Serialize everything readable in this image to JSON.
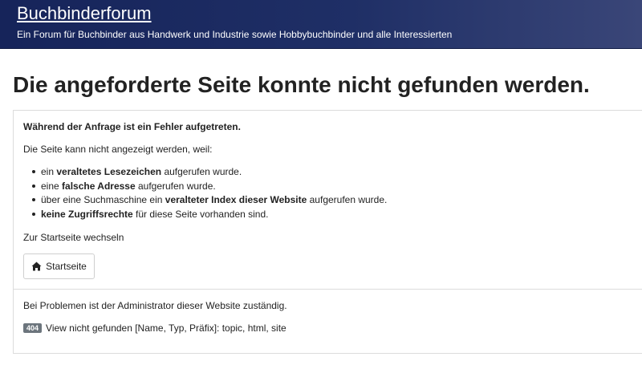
{
  "header": {
    "site_title": "Buchbinderforum",
    "site_description": "Ein Forum für Buchbinder aus Handwerk und Industrie sowie Hobbybuchbinder und alle Interessierten"
  },
  "page": {
    "title": "Die angeforderte Seite konnte nicht gefunden werden."
  },
  "error_card": {
    "heading": "Während der Anfrage ist ein Fehler aufgetreten.",
    "reason_intro": "Die Seite kann nicht angezeigt werden, weil:",
    "reasons": [
      {
        "pre": "ein ",
        "bold": "veraltetes Lesezeichen",
        "post": " aufgerufen wurde."
      },
      {
        "pre": "eine ",
        "bold": "falsche Adresse",
        "post": " aufgerufen wurde."
      },
      {
        "pre": "über eine Suchmaschine ein ",
        "bold": "veralteter Index dieser Website",
        "post": " aufgerufen wurde."
      },
      {
        "pre": "",
        "bold": "keine Zugriffsrechte",
        "post": " für diese Seite vorhanden sind."
      }
    ],
    "home_intro": "Zur Startseite wechseln",
    "home_button_label": "Startseite",
    "home_icon": "home-icon",
    "admin_note": "Bei Problemen ist der Administrator dieser Website zuständig.",
    "error_code": "404",
    "error_message": "View nicht gefunden [Name, Typ, Präfix]: topic, html, site"
  },
  "colors": {
    "header_bg": "#1f2f66",
    "badge_bg": "#6c757d",
    "border": "#dcdcdc"
  }
}
